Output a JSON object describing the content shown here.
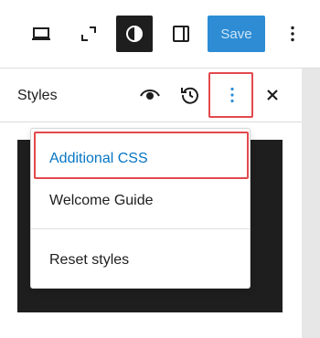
{
  "toolbar": {
    "save_label": "Save",
    "icons": [
      "desktop-icon",
      "fullscreen-icon",
      "styles-contrast-icon",
      "settings-sidebar-icon",
      "more-vertical-icon"
    ]
  },
  "panel": {
    "title": "Styles",
    "icons": [
      "eye-icon",
      "revisions-icon",
      "more-vertical-icon",
      "close-icon"
    ]
  },
  "menu": {
    "items": [
      {
        "label": "Additional CSS"
      },
      {
        "label": "Welcome Guide"
      },
      {
        "label": "Reset styles"
      }
    ]
  },
  "colors": {
    "accent": "#2d8cd4",
    "link": "#0675c4",
    "highlight": "#e2494d",
    "dark": "#1e1e1e"
  }
}
